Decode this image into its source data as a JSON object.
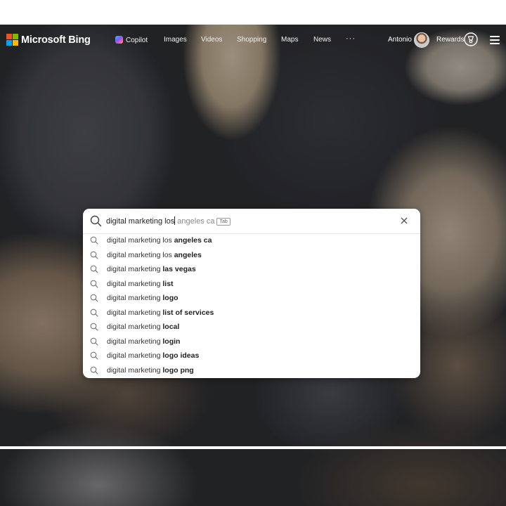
{
  "header": {
    "brand": "Microsoft Bing",
    "logo_colors": [
      "#f25022",
      "#7fba00",
      "#00a4ef",
      "#ffb900"
    ],
    "nav": [
      {
        "label": "Copilot",
        "icon": "copilot-icon"
      },
      {
        "label": "Images"
      },
      {
        "label": "Videos"
      },
      {
        "label": "Shopping"
      },
      {
        "label": "Maps"
      },
      {
        "label": "News"
      }
    ],
    "more": "···",
    "user_name": "Antonio",
    "rewards_label": "Rewards"
  },
  "search": {
    "typed": "digital marketing los",
    "completion": " angeles ca",
    "tab_hint": "Tab",
    "suggestions": [
      {
        "prefix": "digital marketing los ",
        "bold": "angeles ca"
      },
      {
        "prefix": "digital marketing los ",
        "bold": "angeles"
      },
      {
        "prefix": "digital marketing ",
        "bold": "las vegas"
      },
      {
        "prefix": "digital marketing ",
        "bold": "list"
      },
      {
        "prefix": "digital marketing ",
        "bold": "logo"
      },
      {
        "prefix": "digital marketing ",
        "bold": "list of services"
      },
      {
        "prefix": "digital marketing ",
        "bold": "local"
      },
      {
        "prefix": "digital marketing ",
        "bold": "login"
      },
      {
        "prefix": "digital marketing ",
        "bold": "logo ideas"
      },
      {
        "prefix": "digital marketing ",
        "bold": "logo png"
      }
    ]
  }
}
